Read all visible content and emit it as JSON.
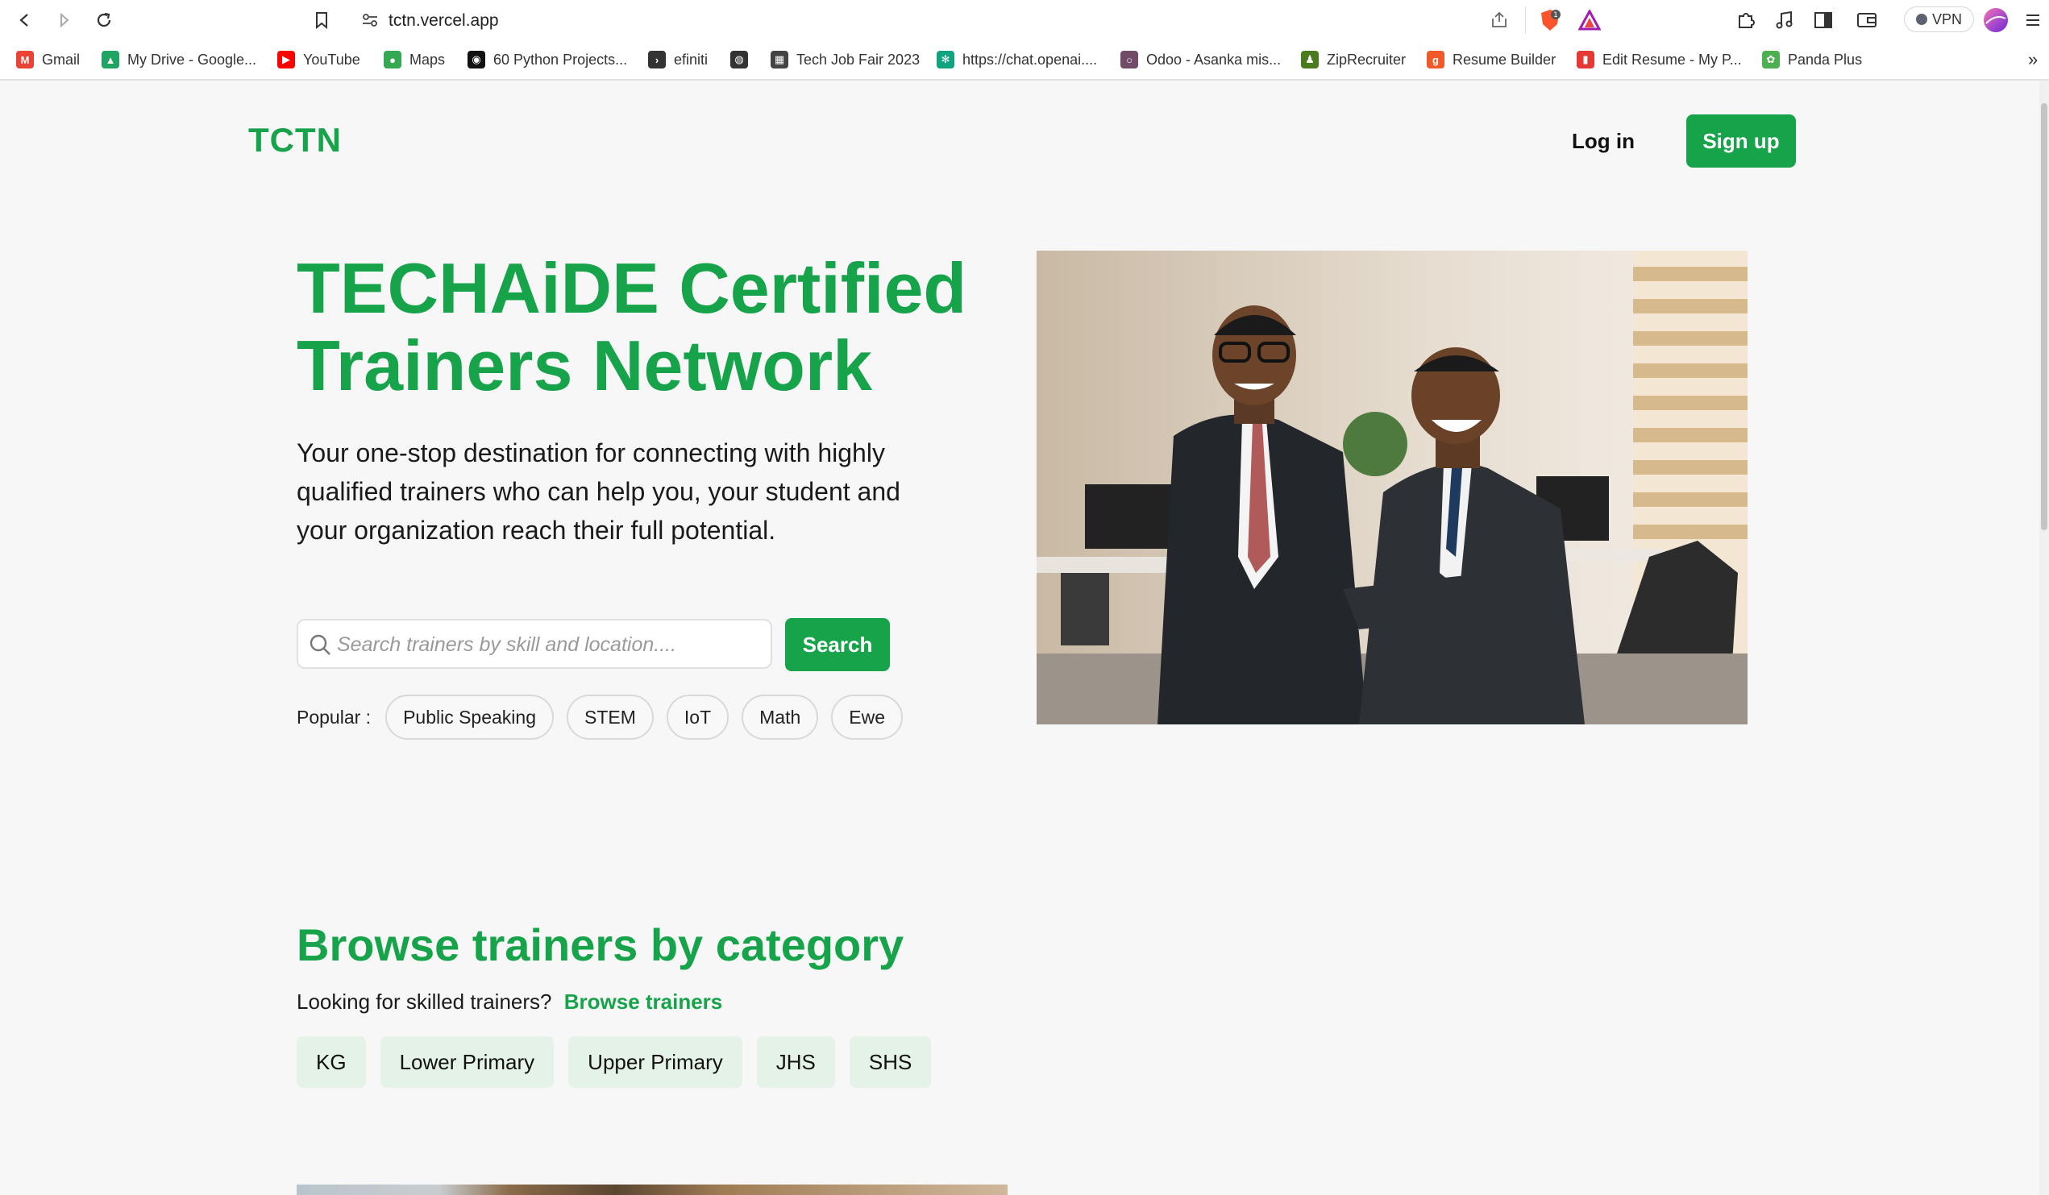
{
  "browser": {
    "url": "tctn.vercel.app",
    "vpn_label": "VPN",
    "bookmarks": [
      {
        "label": "Gmail",
        "icon": "gmail-icon",
        "color": "#ea4335"
      },
      {
        "label": "My Drive - Google...",
        "icon": "drive-icon",
        "color": "#1fa463"
      },
      {
        "label": "YouTube",
        "icon": "youtube-icon",
        "color": "#ff0000"
      },
      {
        "label": "Maps",
        "icon": "maps-icon",
        "color": "#34a853"
      },
      {
        "label": "60 Python Projects...",
        "icon": "medium-icon",
        "color": "#111111"
      },
      {
        "label": "efiniti",
        "icon": "efiniti-icon",
        "color": "#333333"
      },
      {
        "label": "",
        "icon": "globe-icon",
        "color": "#333333"
      },
      {
        "label": "Tech Job Fair 2023",
        "icon": "jobfair-icon",
        "color": "#444444"
      },
      {
        "label": "https://chat.openai....",
        "icon": "openai-icon",
        "color": "#10a37f"
      },
      {
        "label": "Odoo - Asanka mis...",
        "icon": "odoo-icon",
        "color": "#714b67"
      },
      {
        "label": "ZipRecruiter",
        "icon": "ziprecruiter-icon",
        "color": "#4a7c1f"
      },
      {
        "label": "Resume Builder",
        "icon": "resume-builder-icon",
        "color": "#f05a28"
      },
      {
        "label": "Edit Resume - My P...",
        "icon": "edit-resume-icon",
        "color": "#e53935"
      },
      {
        "label": "Panda Plus",
        "icon": "panda-plus-icon",
        "color": "#4caf50"
      }
    ],
    "more_bookmarks": "»"
  },
  "header": {
    "logo": "TCTN",
    "login_label": "Log in",
    "signup_label": "Sign up"
  },
  "hero": {
    "title": "TECHAiDE Certified Trainers Network",
    "subtitle": "Your one-stop destination for connecting with highly qualified trainers who can help you, your student and your organization reach their full potential.",
    "search_placeholder": "Search trainers by skill and location....",
    "search_value": "",
    "search_button": "Search",
    "popular_label": "Popular :",
    "popular_tags": [
      "Public Speaking",
      "STEM",
      "IoT",
      "Math",
      "Ewe"
    ]
  },
  "browse": {
    "title": "Browse trainers by category",
    "subtitle": "Looking for skilled trainers?",
    "link": "Browse trainers",
    "categories": [
      "KG",
      "Lower Primary",
      "Upper Primary",
      "JHS",
      "SHS"
    ]
  },
  "colors": {
    "brand": "#16a34a",
    "category_bg": "#e4f2e8",
    "page_bg": "#f7f7f7"
  }
}
